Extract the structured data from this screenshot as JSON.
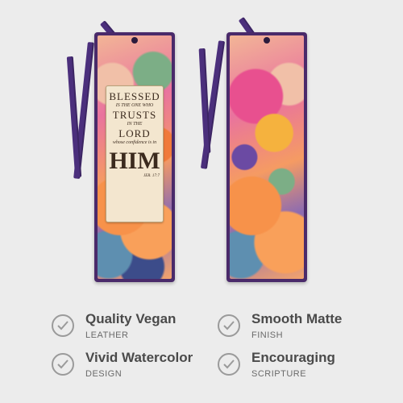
{
  "bookmark": {
    "label_line1": "BLESSED",
    "label_line2": "IS THE ONE WHO",
    "label_line3": "TRUSTS",
    "label_line4": "IN THE",
    "label_line5": "LORD",
    "label_line6": "whose confidence is in",
    "label_line7": "HIM",
    "label_ref": "JER. 17:7"
  },
  "features": [
    {
      "title": "Quality Vegan",
      "subtitle": "LEATHER"
    },
    {
      "title": "Smooth Matte",
      "subtitle": "FINISH"
    },
    {
      "title": "Vivid Watercolor",
      "subtitle": "DESIGN"
    },
    {
      "title": "Encouraging",
      "subtitle": "SCRIPTURE"
    }
  ],
  "colors": {
    "background": "#ececec",
    "ribbon": "#4b2f7c",
    "check": "#9a9a9a"
  },
  "icons": {
    "feature_icon": "check-circle-icon"
  }
}
